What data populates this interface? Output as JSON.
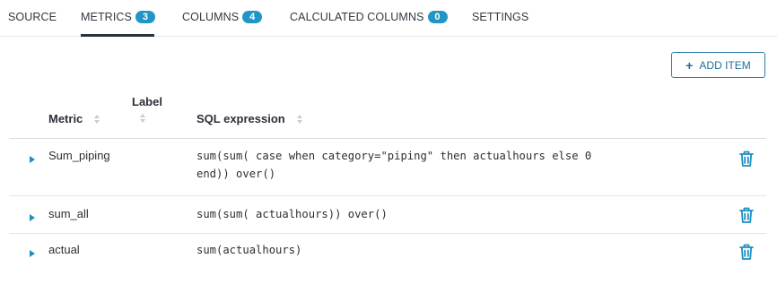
{
  "tabs": [
    {
      "label": "SOURCE"
    },
    {
      "label": "METRICS",
      "badge": "3",
      "active": true
    },
    {
      "label": "COLUMNS",
      "badge": "4"
    },
    {
      "label": "CALCULATED COLUMNS",
      "badge": "0"
    },
    {
      "label": "SETTINGS"
    }
  ],
  "toolbar": {
    "add_item_label": "ADD ITEM",
    "add_item_icon": "plus-icon"
  },
  "table": {
    "columns": {
      "metric": "Metric",
      "label": "Label",
      "sql": "SQL expression"
    },
    "rows": [
      {
        "metric": "Sum_piping",
        "label": "",
        "sql_line1": "sum(sum( case when category=\"piping\" then actualhours else 0",
        "sql_line2": "end)) over()"
      },
      {
        "metric": "sum_all",
        "label": "",
        "sql_line1": "sum(sum( actualhours)) over()",
        "sql_line2": ""
      },
      {
        "metric": "actual",
        "label": "",
        "sql_line1": "sum(actualhours)",
        "sql_line2": ""
      }
    ]
  },
  "colors": {
    "accent": "#2196c4",
    "trash": "#1f8fc0",
    "caret": "#1f8fc0"
  }
}
